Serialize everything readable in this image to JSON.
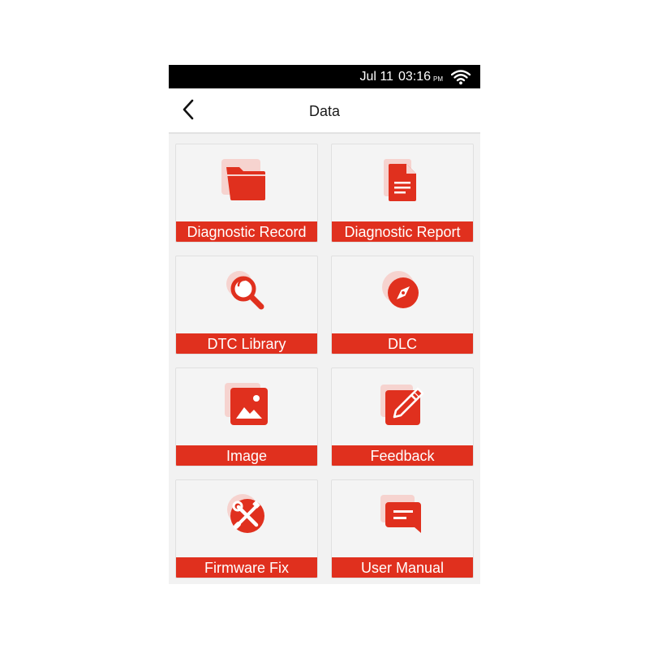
{
  "colors": {
    "accent": "#e0301e",
    "accent_shadow": "#f6d3cf",
    "tile_bg": "#f4f4f4",
    "status_bar": "#000000"
  },
  "status_bar": {
    "date": "Jul 11",
    "time": "03:16",
    "ampm": "PM",
    "wifi_icon": "wifi-icon"
  },
  "header": {
    "back_icon": "chevron-left-icon",
    "title": "Data"
  },
  "tiles": [
    {
      "label": "Diagnostic Record",
      "icon": "folder-icon"
    },
    {
      "label": "Diagnostic Report",
      "icon": "document-icon"
    },
    {
      "label": "DTC Library",
      "icon": "magnifier-icon"
    },
    {
      "label": "DLC",
      "icon": "compass-icon"
    },
    {
      "label": "Image",
      "icon": "image-icon"
    },
    {
      "label": "Feedback",
      "icon": "edit-icon"
    },
    {
      "label": "Firmware Fix",
      "icon": "tools-icon"
    },
    {
      "label": "User Manual",
      "icon": "chat-icon"
    }
  ]
}
